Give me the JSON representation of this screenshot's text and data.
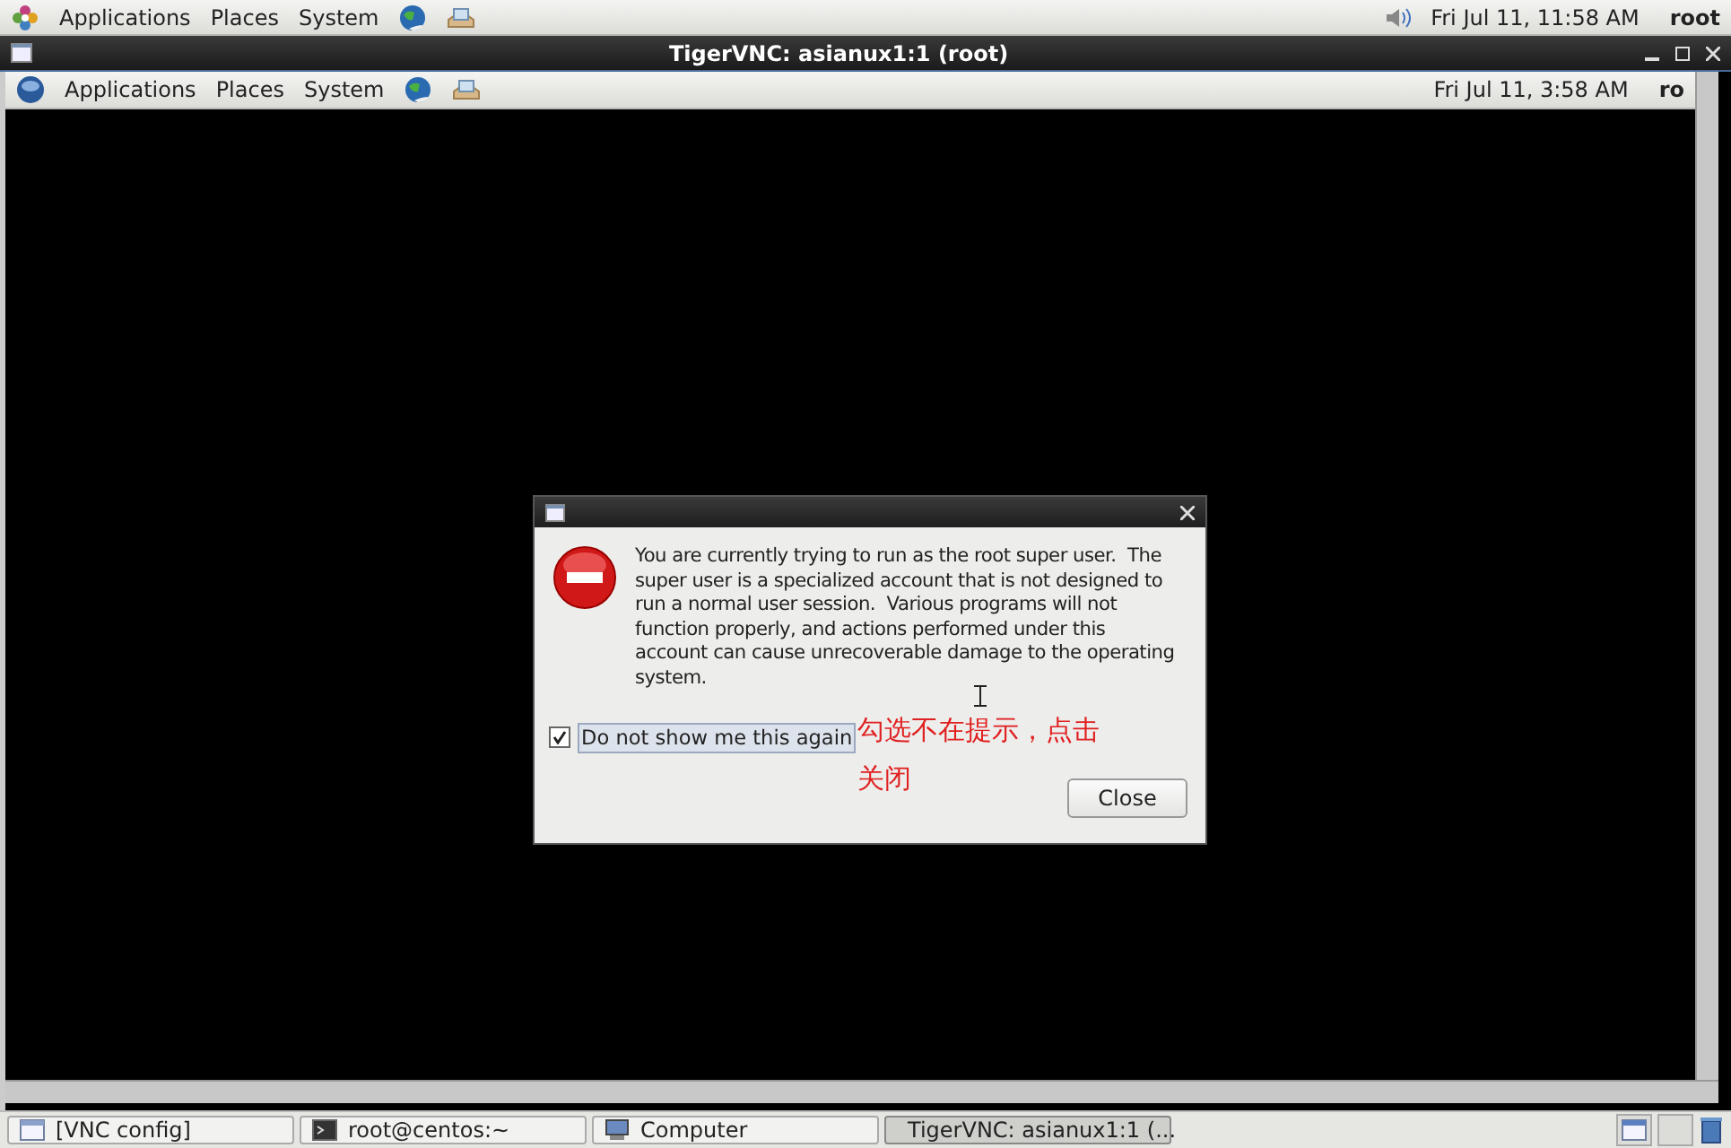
{
  "top_panel": {
    "menus": [
      "Applications",
      "Places",
      "System"
    ],
    "clock": "Fri Jul 11, 11:58 AM",
    "user": "root"
  },
  "vnc_window": {
    "title": "TigerVNC: asianux1:1 (root)",
    "inner_panel": {
      "menus": [
        "Applications",
        "Places",
        "System"
      ],
      "clock": "Fri Jul 11,  3:58 AM",
      "user": "ro"
    },
    "dialog": {
      "message": "You are currently trying to run as the root super user.  The super user is a specialized account that is not designed to run a normal user session.  Various programs will not function properly, and actions performed under this account can cause unrecoverable damage to the operating system.",
      "checkbox": {
        "label": "Do not show me this again",
        "checked": true
      },
      "button": "Close"
    },
    "annotation": [
      "勾选不在提示，点击",
      "关闭"
    ]
  },
  "taskbar": [
    {
      "label": "[VNC config]",
      "kind": "window",
      "selected": false
    },
    {
      "label": "root@centos:~",
      "kind": "terminal",
      "selected": false
    },
    {
      "label": "Computer",
      "kind": "computer",
      "selected": false
    },
    {
      "label": "TigerVNC: asianux1:1 (...",
      "kind": "window",
      "selected": true
    }
  ]
}
